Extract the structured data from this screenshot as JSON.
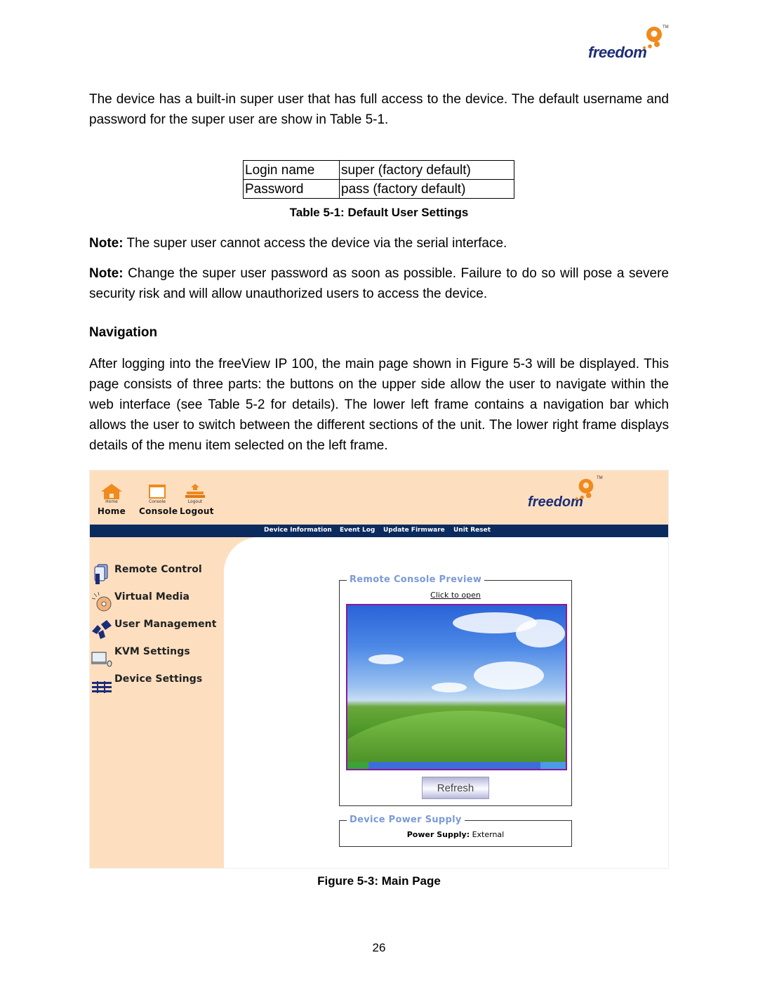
{
  "brand": {
    "name": "freedom",
    "numeral": "9",
    "tm": "TM",
    "colors": {
      "navy": "#1c2c78",
      "orange": "#f08a1c"
    }
  },
  "intro": {
    "text": "The device has a built-in super user that has full access to the device.   The default username and password for the super user are show in Table 5-1."
  },
  "table_5_1": {
    "rows": [
      {
        "label": "Login name",
        "value": "super (factory default)"
      },
      {
        "label": "Password",
        "value": "pass (factory default)"
      }
    ],
    "caption": "Table 5-1: Default User Settings"
  },
  "notes": [
    {
      "prefix": "Note:",
      "text": " The super user cannot access the device via the serial interface."
    },
    {
      "prefix": "Note:",
      "text": " Change the super user password as soon as possible.  Failure to do so will pose a severe security risk and will allow unauthorized users to access the device."
    }
  ],
  "navigation": {
    "heading": "Navigation",
    "text": "After logging into the freeView IP 100, the main page shown in Figure 5-3 will be displayed. This page consists of three parts: the buttons on the upper side allow the user to navigate within the web interface (see Table 5-2 for details). The lower left frame contains a navigation bar which allows the user to switch between the different sections of the unit. The lower right frame displays details of the menu item selected on the left frame."
  },
  "figure": {
    "toolbar": [
      {
        "small": "Home",
        "label": "Home",
        "icon": "home-icon"
      },
      {
        "small": "Console",
        "label": "Console",
        "icon": "console-icon"
      },
      {
        "small": "Logout",
        "label": "Logout",
        "icon": "logout-icon"
      }
    ],
    "navbar": [
      "Device Information",
      "Event Log",
      "Update Firmware",
      "Unit Reset"
    ],
    "menu": [
      {
        "label": "Remote Control",
        "icon": "remote-control-icon"
      },
      {
        "label": "Virtual Media",
        "icon": "virtual-media-icon"
      },
      {
        "label": "User Management",
        "icon": "user-management-icon"
      },
      {
        "label": "KVM Settings",
        "icon": "kvm-settings-icon"
      },
      {
        "label": "Device Settings",
        "icon": "device-settings-icon"
      }
    ],
    "preview": {
      "legend": "Remote Console Preview",
      "link": "Click to open",
      "refresh": "Refresh"
    },
    "power": {
      "legend": "Device Power Supply",
      "label": "Power Supply:",
      "value": "External"
    },
    "colors": {
      "panel": "#fddfc0",
      "navbar": "#0b2a5e",
      "legend": "#7b9ad6",
      "preview_border": "#8a1a9a"
    }
  },
  "figure_caption": "Figure 5-3: Main Page",
  "page_number": "26"
}
